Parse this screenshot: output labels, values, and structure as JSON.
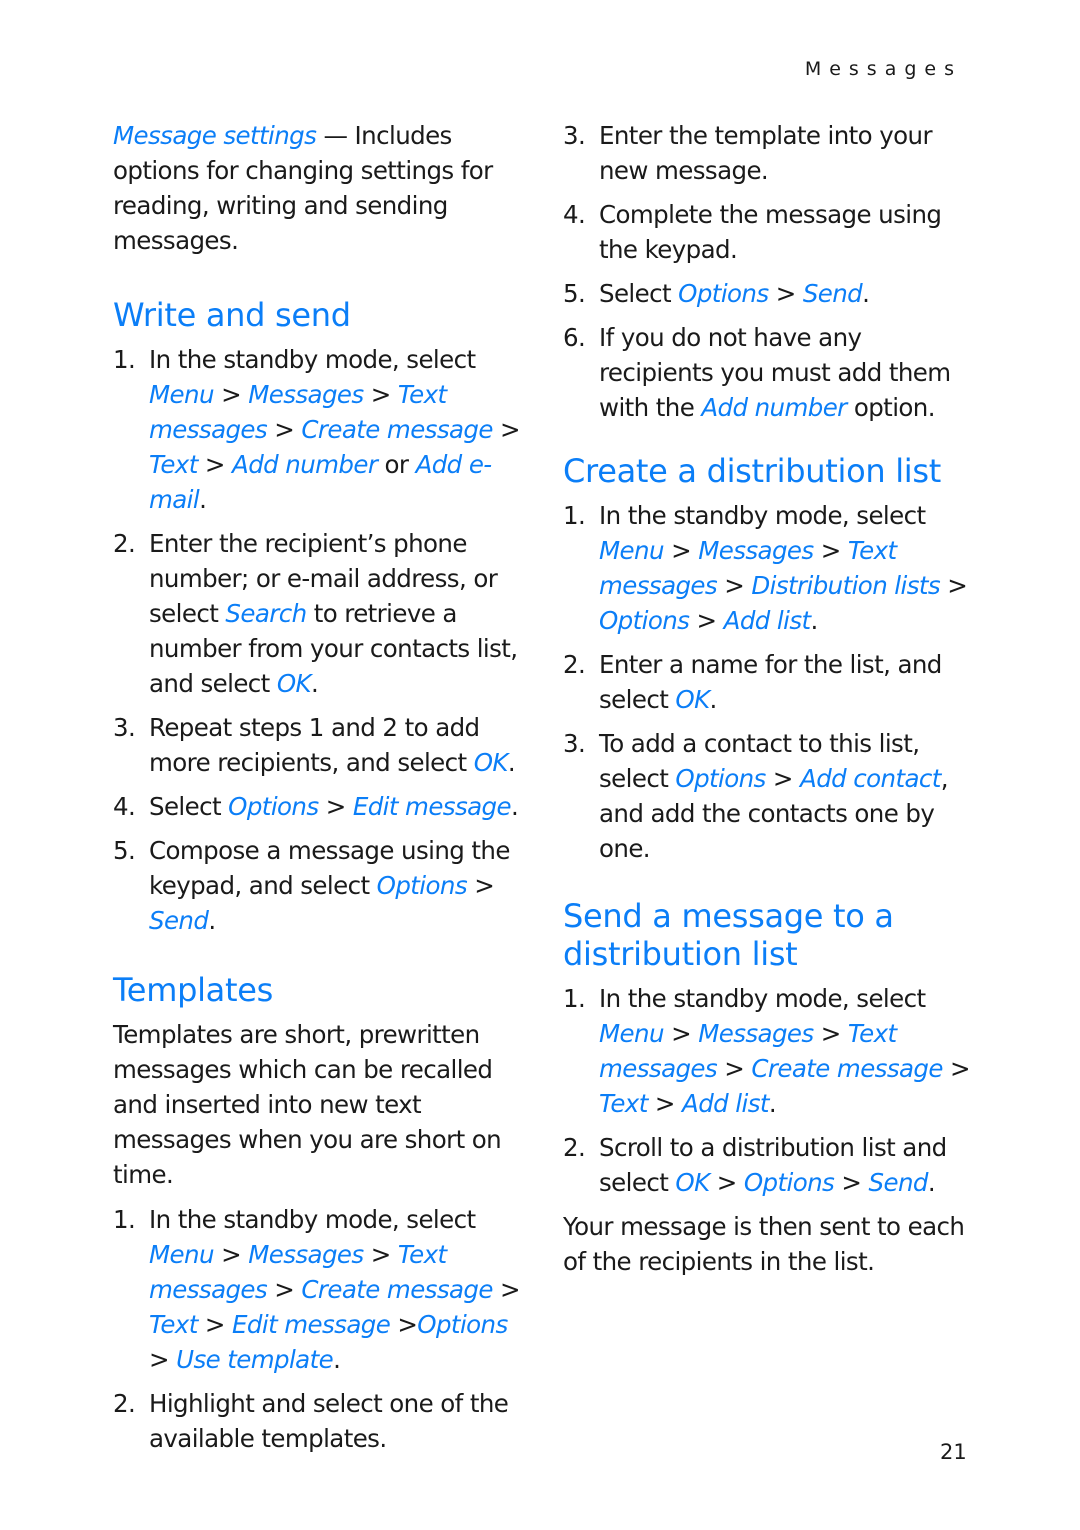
{
  "header": {
    "section": "Messages"
  },
  "page_number": "21",
  "colors": {
    "link": "#0b7ef7",
    "text": "#1a1a1a"
  },
  "left": {
    "intro": [
      {
        "t": "Message settings",
        "link": true
      },
      {
        "t": " — Includes options for changing settings for reading, writing and sending messages."
      }
    ],
    "write_and_send": {
      "title": "Write and send",
      "steps": [
        {
          "n": "1.",
          "parts": [
            {
              "t": "In the standby mode, select "
            },
            {
              "t": "Menu",
              "link": true
            },
            {
              "t": " > "
            },
            {
              "t": "Messages",
              "link": true
            },
            {
              "t": " > "
            },
            {
              "t": "Text messages",
              "link": true
            },
            {
              "t": " > "
            },
            {
              "t": "Create message",
              "link": true
            },
            {
              "t": " > "
            },
            {
              "t": "Text",
              "link": true
            },
            {
              "t": " > "
            },
            {
              "t": "Add number",
              "link": true
            },
            {
              "t": " or "
            },
            {
              "t": "Add e-mail",
              "link": true
            },
            {
              "t": "."
            }
          ]
        },
        {
          "n": "2.",
          "parts": [
            {
              "t": "Enter the recipient’s phone number; or e-mail address, or select "
            },
            {
              "t": "Search",
              "link": true
            },
            {
              "t": " to retrieve a number from your contacts list, and select "
            },
            {
              "t": "OK",
              "link": true
            },
            {
              "t": "."
            }
          ]
        },
        {
          "n": "3.",
          "parts": [
            {
              "t": "Repeat steps 1 and 2 to add more recipients, and select "
            },
            {
              "t": "OK",
              "link": true
            },
            {
              "t": "."
            }
          ]
        },
        {
          "n": "4.",
          "parts": [
            {
              "t": "Select "
            },
            {
              "t": "Options",
              "link": true
            },
            {
              "t": " > "
            },
            {
              "t": "Edit message",
              "link": true
            },
            {
              "t": "."
            }
          ]
        },
        {
          "n": "5.",
          "parts": [
            {
              "t": "Compose a message using the keypad, and select "
            },
            {
              "t": "Options",
              "link": true
            },
            {
              "t": " > "
            },
            {
              "t": "Send",
              "link": true
            },
            {
              "t": "."
            }
          ]
        }
      ]
    },
    "templates": {
      "title": "Templates",
      "intro": "Templates are short, prewritten messages which can be recalled and inserted into new text messages when you are short on time.",
      "steps": [
        {
          "n": "1.",
          "parts": [
            {
              "t": "In the standby mode, select "
            },
            {
              "t": "Menu",
              "link": true
            },
            {
              "t": " > "
            },
            {
              "t": "Messages",
              "link": true
            },
            {
              "t": " > "
            },
            {
              "t": "Text messages",
              "link": true
            },
            {
              "t": " > "
            },
            {
              "t": "Create message",
              "link": true
            },
            {
              "t": " > "
            },
            {
              "t": "Text",
              "link": true
            },
            {
              "t": " > "
            },
            {
              "t": "Edit message",
              "link": true
            },
            {
              "t": " >"
            },
            {
              "t": "Options",
              "link": true
            },
            {
              "t": " > "
            },
            {
              "t": "Use template",
              "link": true
            },
            {
              "t": "."
            }
          ]
        },
        {
          "n": "2.",
          "parts": [
            {
              "t": "Highlight and select one of the available templates."
            }
          ]
        }
      ]
    }
  },
  "right": {
    "templates_cont": {
      "steps": [
        {
          "n": "3.",
          "parts": [
            {
              "t": "Enter the template into your new message."
            }
          ]
        },
        {
          "n": "4.",
          "parts": [
            {
              "t": "Complete the message using the keypad."
            }
          ]
        },
        {
          "n": "5.",
          "parts": [
            {
              "t": "Select "
            },
            {
              "t": "Options",
              "link": true
            },
            {
              "t": " > "
            },
            {
              "t": "Send",
              "link": true
            },
            {
              "t": "."
            }
          ]
        },
        {
          "n": "6.",
          "parts": [
            {
              "t": "If you do not have any recipients you must add them with the "
            },
            {
              "t": "Add number",
              "link": true
            },
            {
              "t": " option."
            }
          ]
        }
      ]
    },
    "create_list": {
      "title": "Create a distribution list",
      "steps": [
        {
          "n": "1.",
          "parts": [
            {
              "t": "In the standby mode, select "
            },
            {
              "t": "Menu",
              "link": true
            },
            {
              "t": " > "
            },
            {
              "t": "Messages",
              "link": true
            },
            {
              "t": " > "
            },
            {
              "t": "Text messages",
              "link": true
            },
            {
              "t": " > "
            },
            {
              "t": "Distribution lists",
              "link": true
            },
            {
              "t": " > "
            },
            {
              "t": "Options",
              "link": true
            },
            {
              "t": " > "
            },
            {
              "t": "Add list",
              "link": true
            },
            {
              "t": "."
            }
          ]
        },
        {
          "n": "2.",
          "parts": [
            {
              "t": "Enter a name for the list, and select "
            },
            {
              "t": "OK",
              "link": true
            },
            {
              "t": "."
            }
          ]
        },
        {
          "n": "3.",
          "parts": [
            {
              "t": "To add a contact to this list, select "
            },
            {
              "t": "Options",
              "link": true
            },
            {
              "t": " > "
            },
            {
              "t": "Add contact",
              "link": true
            },
            {
              "t": ", and add the contacts one by one."
            }
          ]
        }
      ]
    },
    "send_to_list": {
      "title": "Send a message to a distribution list",
      "steps": [
        {
          "n": "1.",
          "parts": [
            {
              "t": "In the standby mode, select "
            },
            {
              "t": "Menu",
              "link": true
            },
            {
              "t": " > "
            },
            {
              "t": "Messages",
              "link": true
            },
            {
              "t": " > "
            },
            {
              "t": "Text messages",
              "link": true
            },
            {
              "t": " > "
            },
            {
              "t": "Create message",
              "link": true
            },
            {
              "t": " > "
            },
            {
              "t": "Text",
              "link": true
            },
            {
              "t": " > "
            },
            {
              "t": "Add list",
              "link": true
            },
            {
              "t": "."
            }
          ]
        },
        {
          "n": "2.",
          "parts": [
            {
              "t": "Scroll to a distribution list and select "
            },
            {
              "t": "OK",
              "link": true
            },
            {
              "t": " > "
            },
            {
              "t": "Options",
              "link": true
            },
            {
              "t": " > "
            },
            {
              "t": "Send",
              "link": true
            },
            {
              "t": "."
            }
          ]
        }
      ],
      "outro": "Your message is then sent to each of the recipients in the list."
    }
  }
}
